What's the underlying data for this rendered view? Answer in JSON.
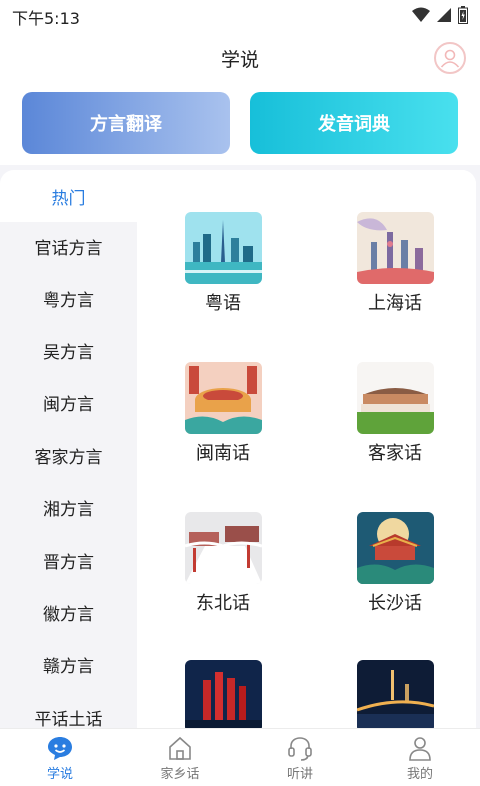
{
  "status_bar": {
    "time": "下午5:13",
    "icons": [
      "wifi-icon",
      "cell-signal-icon",
      "battery-icon"
    ]
  },
  "header": {
    "title": "学说",
    "avatar_icon": "user-avatar-icon"
  },
  "features": {
    "translate_label": "方言翻译",
    "dictionary_label": "发音词典"
  },
  "categories": [
    {
      "label": "热门",
      "active": true
    },
    {
      "label": "官话方言"
    },
    {
      "label": "粤方言"
    },
    {
      "label": "吴方言"
    },
    {
      "label": "闽方言"
    },
    {
      "label": "客家方言"
    },
    {
      "label": "湘方言"
    },
    {
      "label": "晋方言"
    },
    {
      "label": "徽方言"
    },
    {
      "label": "赣方言"
    },
    {
      "label": "平话土话"
    }
  ],
  "dialects": [
    {
      "label": "粤语"
    },
    {
      "label": "上海话"
    },
    {
      "label": "闽南话"
    },
    {
      "label": "客家话"
    },
    {
      "label": "东北话"
    },
    {
      "label": "长沙话"
    },
    {
      "label": ""
    },
    {
      "label": ""
    }
  ],
  "tabs": [
    {
      "label": "学说",
      "icon": "chat-smile-icon",
      "active": true
    },
    {
      "label": "家乡话",
      "icon": "home-icon"
    },
    {
      "label": "听讲",
      "icon": "headset-icon"
    },
    {
      "label": "我的",
      "icon": "user-icon"
    }
  ],
  "colors": {
    "accent": "#2a7de0",
    "translate_gradient": [
      "#5b87d8",
      "#a9c2ee"
    ],
    "dictionary_gradient": [
      "#17bfd9",
      "#49e0ee"
    ]
  }
}
